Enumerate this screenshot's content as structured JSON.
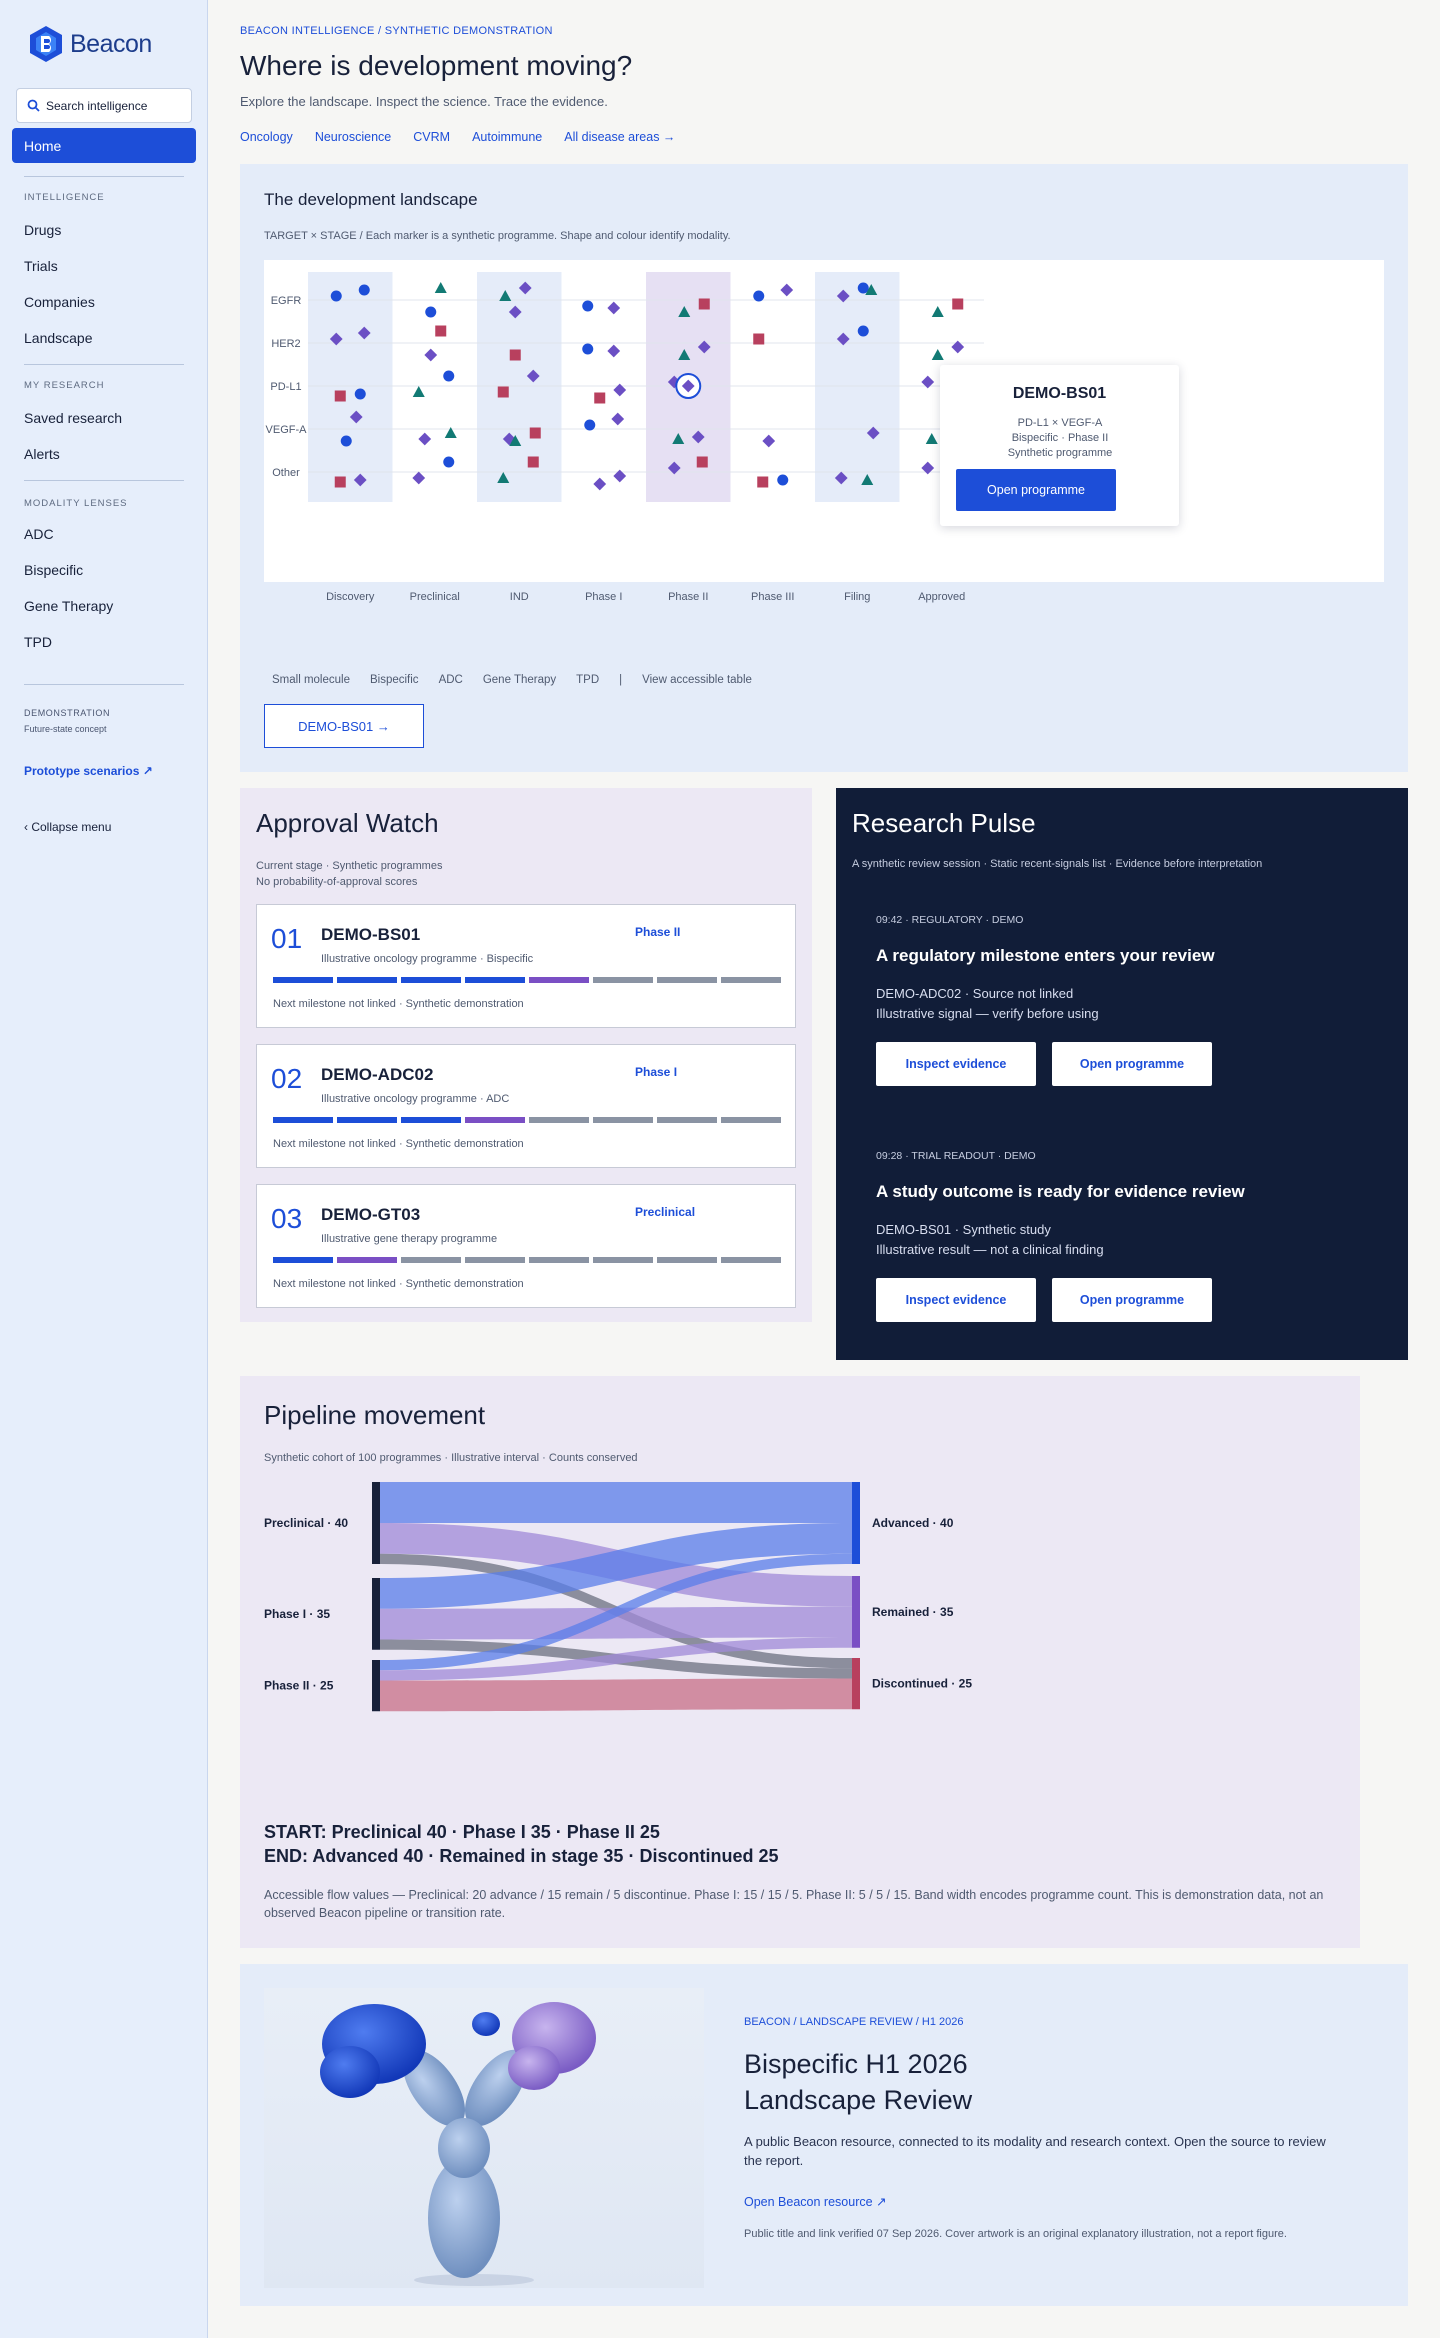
{
  "sidebar": {
    "brand": "Beacon",
    "search_placeholder": "Search intelligence",
    "home": "Home",
    "intelligence_label": "INTELLIGENCE",
    "intelligence_items": [
      "Drugs",
      "Trials",
      "Companies",
      "Landscape"
    ],
    "research_label": "MY RESEARCH",
    "research_items": [
      "Saved research",
      "Alerts"
    ],
    "modality_label": "MODALITY LENSES",
    "modality_items": [
      "ADC",
      "Bispecific",
      "Gene Therapy",
      "TPD"
    ],
    "demo_label": "DEMONSTRATION",
    "demo_sub": "Future-state concept",
    "prototype": "Prototype scenarios ↗",
    "collapse": "‹ Collapse menu"
  },
  "header": {
    "eyebrow": "BEACON INTELLIGENCE / SYNTHETIC DEMONSTRATION",
    "title": "Where is development moving?",
    "subtitle": "Explore the landscape. Inspect the science. Trace the evidence.",
    "areas": [
      "Oncology",
      "Neuroscience",
      "CVRM",
      "Autoimmune",
      "All disease areas →"
    ]
  },
  "landscape": {
    "title": "The development landscape",
    "subtitle": "TARGET × STAGE   /   Each marker is a synthetic programme. Shape and colour identify modality.",
    "legend": [
      "Small molecule",
      "Bispecific",
      "ADC",
      "Gene Therapy",
      "TPD",
      "|",
      "View accessible table"
    ],
    "selected_button": "DEMO-BS01 →",
    "tooltip": {
      "title": "DEMO-BS01",
      "line1": "PD-L1 × VEGF-A",
      "line2": "Bispecific · Phase II",
      "line3": "Synthetic programme",
      "button": "Open programme"
    }
  },
  "chart_data": {
    "type": "scatter",
    "x_categories": [
      "Discovery",
      "Preclinical",
      "IND",
      "Phase I",
      "Phase II",
      "Phase III",
      "Filing",
      "Approved"
    ],
    "y_categories": [
      "EGFR",
      "HER2",
      "PD-L1",
      "VEGF-A",
      "Other"
    ],
    "series": [
      {
        "name": "Small molecule",
        "color": "#1d4ed8",
        "shape": "circle",
        "points": [
          [
            "Discovery",
            "EGFR"
          ],
          [
            "Discovery",
            "EGFR"
          ],
          [
            "Preclinical",
            "EGFR"
          ],
          [
            "Phase I",
            "EGFR"
          ],
          [
            "Phase III",
            "EGFR"
          ],
          [
            "Filing",
            "EGFR"
          ],
          [
            "Phase I",
            "HER2"
          ],
          [
            "Filing",
            "HER2"
          ],
          [
            "Discovery",
            "PD-L1"
          ],
          [
            "Preclinical",
            "PD-L1"
          ],
          [
            "Discovery",
            "VEGF-A"
          ],
          [
            "Phase I",
            "VEGF-A"
          ],
          [
            "Preclinical",
            "Other"
          ],
          [
            "Phase III",
            "Other"
          ]
        ]
      },
      {
        "name": "Bispecific",
        "color": "#6b4fc4",
        "shape": "diamond",
        "points": [
          [
            "Discovery",
            "HER2"
          ],
          [
            "Discovery",
            "HER2"
          ],
          [
            "Preclinical",
            "HER2"
          ],
          [
            "IND",
            "EGFR"
          ],
          [
            "IND",
            "EGFR"
          ],
          [
            "Phase I",
            "EGFR"
          ],
          [
            "Phase I",
            "HER2"
          ],
          [
            "Phase I",
            "PD-L1"
          ],
          [
            "Phase II",
            "HER2"
          ],
          [
            "Phase II",
            "PD-L1"
          ],
          [
            "Phase III",
            "EGFR"
          ],
          [
            "Filing",
            "EGFR"
          ],
          [
            "Filing",
            "HER2"
          ],
          [
            "Approved",
            "HER2"
          ],
          [
            "Approved",
            "PD-L1"
          ],
          [
            "IND",
            "PD-L1"
          ],
          [
            "Discovery",
            "VEGF-A"
          ],
          [
            "Preclinical",
            "VEGF-A"
          ],
          [
            "IND",
            "VEGF-A"
          ],
          [
            "Phase I",
            "VEGF-A"
          ],
          [
            "Phase II",
            "VEGF-A"
          ],
          [
            "Phase III",
            "VEGF-A"
          ],
          [
            "Filing",
            "VEGF-A"
          ],
          [
            "Discovery",
            "Other"
          ],
          [
            "Preclinical",
            "Other"
          ],
          [
            "Phase I",
            "Other"
          ],
          [
            "Phase I",
            "Other"
          ],
          [
            "Phase II",
            "Other"
          ],
          [
            "Filing",
            "Other"
          ],
          [
            "Approved",
            "Other"
          ]
        ]
      },
      {
        "name": "ADC",
        "color": "#b8405e",
        "shape": "square",
        "points": [
          [
            "Preclinical",
            "HER2"
          ],
          [
            "IND",
            "HER2"
          ],
          [
            "Phase I",
            "PD-L1"
          ],
          [
            "Phase II",
            "EGFR"
          ],
          [
            "Phase III",
            "HER2"
          ],
          [
            "Approved",
            "EGFR"
          ],
          [
            "Discovery",
            "PD-L1"
          ],
          [
            "IND",
            "PD-L1"
          ],
          [
            "Approved",
            "PD-L1"
          ],
          [
            "IND",
            "VEGF-A"
          ],
          [
            "Approved",
            "VEGF-A"
          ],
          [
            "Discovery",
            "Other"
          ],
          [
            "IND",
            "Other"
          ],
          [
            "Phase II",
            "Other"
          ],
          [
            "Phase III",
            "Other"
          ]
        ]
      },
      {
        "name": "Gene Therapy",
        "color": "#127a74",
        "shape": "triangle",
        "points": [
          [
            "Preclinical",
            "EGFR"
          ],
          [
            "IND",
            "EGFR"
          ],
          [
            "Phase II",
            "EGFR"
          ],
          [
            "Filing",
            "EGFR"
          ],
          [
            "Approved",
            "EGFR"
          ],
          [
            "Phase II",
            "HER2"
          ],
          [
            "Approved",
            "HER2"
          ],
          [
            "Preclinical",
            "PD-L1"
          ],
          [
            "Preclinical",
            "VEGF-A"
          ],
          [
            "IND",
            "VEGF-A"
          ],
          [
            "Phase II",
            "VEGF-A"
          ],
          [
            "Approved",
            "VEGF-A"
          ],
          [
            "IND",
            "Other"
          ],
          [
            "Filing",
            "Other"
          ],
          [
            "Approved",
            "Other"
          ]
        ]
      }
    ],
    "highlight": {
      "name": "DEMO-BS01",
      "x": "Phase II",
      "y": "PD-L1"
    }
  },
  "approval": {
    "title": "Approval Watch",
    "sub1": "Current stage · Synthetic programmes",
    "sub2": "No probability-of-approval scores",
    "cards": [
      {
        "num": "01",
        "name": "DEMO-BS01",
        "desc": "Illustrative oncology programme · Bispecific",
        "phase": "Phase II",
        "stage_index": 4,
        "foot": "Next milestone not linked · Synthetic demonstration"
      },
      {
        "num": "02",
        "name": "DEMO-ADC02",
        "desc": "Illustrative oncology programme · ADC",
        "phase": "Phase I",
        "stage_index": 3,
        "foot": "Next milestone not linked · Synthetic demonstration"
      },
      {
        "num": "03",
        "name": "DEMO-GT03",
        "desc": "Illustrative gene therapy programme",
        "phase": "Preclinical",
        "stage_index": 1,
        "foot": "Next milestone not linked · Synthetic demonstration"
      }
    ]
  },
  "pulse": {
    "title": "Research Pulse",
    "subtitle": "A synthetic review session · Static recent-signals list · Evidence before interpretation",
    "items": [
      {
        "tag": "09:42 · REGULATORY · DEMO",
        "headline": "A regulatory milestone enters your review",
        "line1": "DEMO-ADC02 · Source not linked",
        "line2": "Illustrative signal — verify before using",
        "btn1": "Inspect evidence",
        "btn2": "Open programme"
      },
      {
        "tag": "09:28 · TRIAL READOUT · DEMO",
        "headline": "A study outcome is ready for evidence review",
        "line1": "DEMO-BS01 · Synthetic study",
        "line2": "Illustrative result — not a clinical finding",
        "btn1": "Inspect evidence",
        "btn2": "Open programme"
      }
    ]
  },
  "pipeline": {
    "title": "Pipeline movement",
    "subtitle": "Synthetic cohort of 100 programmes · Illustrative interval · Counts conserved",
    "sources": [
      "Preclinical · 40",
      "Phase I · 35",
      "Phase II · 25"
    ],
    "targets": [
      "Advanced · 40",
      "Remained · 35",
      "Discontinued · 25"
    ],
    "start": "START: Preclinical 40 · Phase I 35 · Phase II 25",
    "end": "END: Advanced 40 · Remained in stage 35 · Discontinued 25",
    "accessible": "Accessible flow values — Preclinical: 20 advance / 15 remain / 5 discontinue. Phase I: 15 / 15 / 5. Phase II: 5 / 5 / 15. Band width encodes programme count. This is demonstration data, not an observed Beacon pipeline or transition rate.",
    "flows": [
      [
        20,
        15,
        5
      ],
      [
        15,
        15,
        5
      ],
      [
        5,
        5,
        15
      ]
    ]
  },
  "review": {
    "eyebrow": "BEACON / LANDSCAPE REVIEW / H1 2026",
    "title": "Bispecific H1 2026 Landscape Review",
    "desc": "A public Beacon resource, connected to its modality and research context. Open the source to review the report.",
    "link": "Open Beacon resource ↗",
    "foot": "Public title and link verified 07 Sep 2026. Cover artwork is an original explanatory illustration, not a report figure."
  },
  "colors": {
    "accent": "#1d4ed8",
    "bispecific": "#6b4fc4",
    "adc": "#b8405e",
    "gene_therapy": "#127a74",
    "dark": "#111d38"
  }
}
